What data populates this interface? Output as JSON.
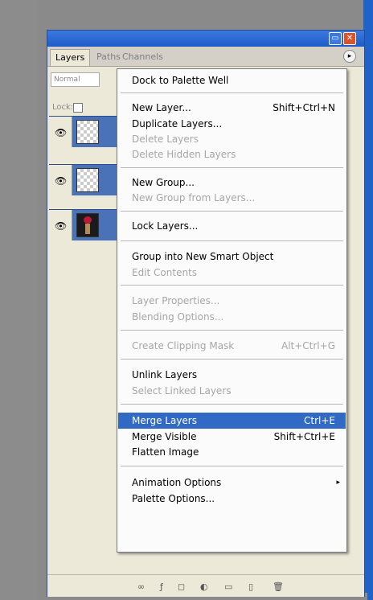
{
  "palette": {
    "tabs": [
      {
        "label": "Layers"
      },
      {
        "label": "Paths"
      },
      {
        "label": "Channels"
      }
    ],
    "blend_mode": "Normal",
    "lock_label": "Lock:",
    "layers": [
      {
        "thumbnail": "transparent"
      },
      {
        "thumbnail": "transparent"
      },
      {
        "thumbnail": "photo"
      }
    ]
  },
  "menu": {
    "items": [
      {
        "label": "Dock to Palette Well",
        "shortcut": "",
        "enabled": true
      },
      {
        "label": "New Layer...",
        "shortcut": "Shift+Ctrl+N",
        "enabled": true
      },
      {
        "label": "Duplicate Layers...",
        "shortcut": "",
        "enabled": true
      },
      {
        "label": "Delete Layers",
        "shortcut": "",
        "enabled": false
      },
      {
        "label": "Delete Hidden Layers",
        "shortcut": "",
        "enabled": false
      },
      {
        "label": "New Group...",
        "shortcut": "",
        "enabled": true
      },
      {
        "label": "New Group from Layers...",
        "shortcut": "",
        "enabled": false
      },
      {
        "label": "Lock Layers...",
        "shortcut": "",
        "enabled": true
      },
      {
        "label": "Group into New Smart Object",
        "shortcut": "",
        "enabled": true
      },
      {
        "label": "Edit Contents",
        "shortcut": "",
        "enabled": false
      },
      {
        "label": "Layer Properties...",
        "shortcut": "",
        "enabled": false
      },
      {
        "label": "Blending Options...",
        "shortcut": "",
        "enabled": false
      },
      {
        "label": "Create Clipping Mask",
        "shortcut": "Alt+Ctrl+G",
        "enabled": false
      },
      {
        "label": "Unlink Layers",
        "shortcut": "",
        "enabled": true
      },
      {
        "label": "Select Linked Layers",
        "shortcut": "",
        "enabled": false
      },
      {
        "label": "Merge Layers",
        "shortcut": "Ctrl+E",
        "enabled": true,
        "selected": true
      },
      {
        "label": "Merge Visible",
        "shortcut": "Shift+Ctrl+E",
        "enabled": true
      },
      {
        "label": "Flatten Image",
        "shortcut": "",
        "enabled": true
      },
      {
        "label": "Animation Options",
        "shortcut": "",
        "enabled": true,
        "submenu": true
      },
      {
        "label": "Palette Options...",
        "shortcut": "",
        "enabled": true
      }
    ],
    "submenu_arrow": "▸"
  },
  "icons": {
    "eye": "eye-icon",
    "palette_menu": "palette-menu-icon"
  }
}
